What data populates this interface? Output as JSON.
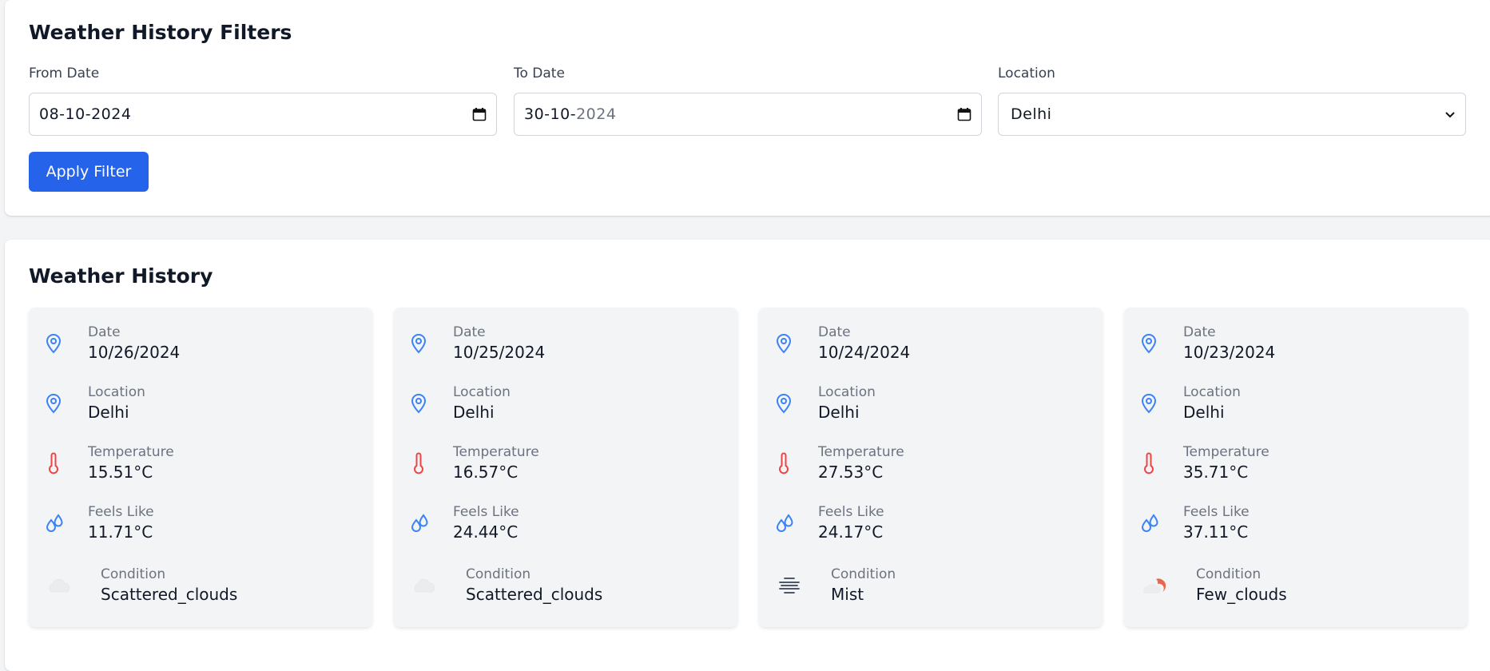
{
  "filters": {
    "title": "Weather History Filters",
    "from_label": "From Date",
    "from_value_day_month": "08-10-",
    "from_value_year": "2024",
    "to_label": "To Date",
    "to_value_day_month": "30-10-",
    "to_value_year": "2024",
    "location_label": "Location",
    "location_value": "Delhi",
    "apply_label": "Apply Filter"
  },
  "history": {
    "title": "Weather History",
    "labels": {
      "date": "Date",
      "location": "Location",
      "temperature": "Temperature",
      "feels_like": "Feels Like",
      "condition": "Condition"
    },
    "cards": [
      {
        "date": "10/26/2024",
        "location": "Delhi",
        "temperature": "15.51°C",
        "feels_like": "11.71°C",
        "condition": "Scattered_clouds",
        "condition_icon": "scattered-clouds-icon"
      },
      {
        "date": "10/25/2024",
        "location": "Delhi",
        "temperature": "16.57°C",
        "feels_like": "24.44°C",
        "condition": "Scattered_clouds",
        "condition_icon": "scattered-clouds-icon"
      },
      {
        "date": "10/24/2024",
        "location": "Delhi",
        "temperature": "27.53°C",
        "feels_like": "24.17°C",
        "condition": "Mist",
        "condition_icon": "mist-icon"
      },
      {
        "date": "10/23/2024",
        "location": "Delhi",
        "temperature": "35.71°C",
        "feels_like": "37.11°C",
        "condition": "Few_clouds",
        "condition_icon": "few-clouds-icon"
      }
    ]
  },
  "colors": {
    "accent": "#2563eb",
    "pin_icon": "#3b82f6",
    "thermometer_icon": "#ef4444",
    "droplet_icon": "#3b82f6"
  }
}
